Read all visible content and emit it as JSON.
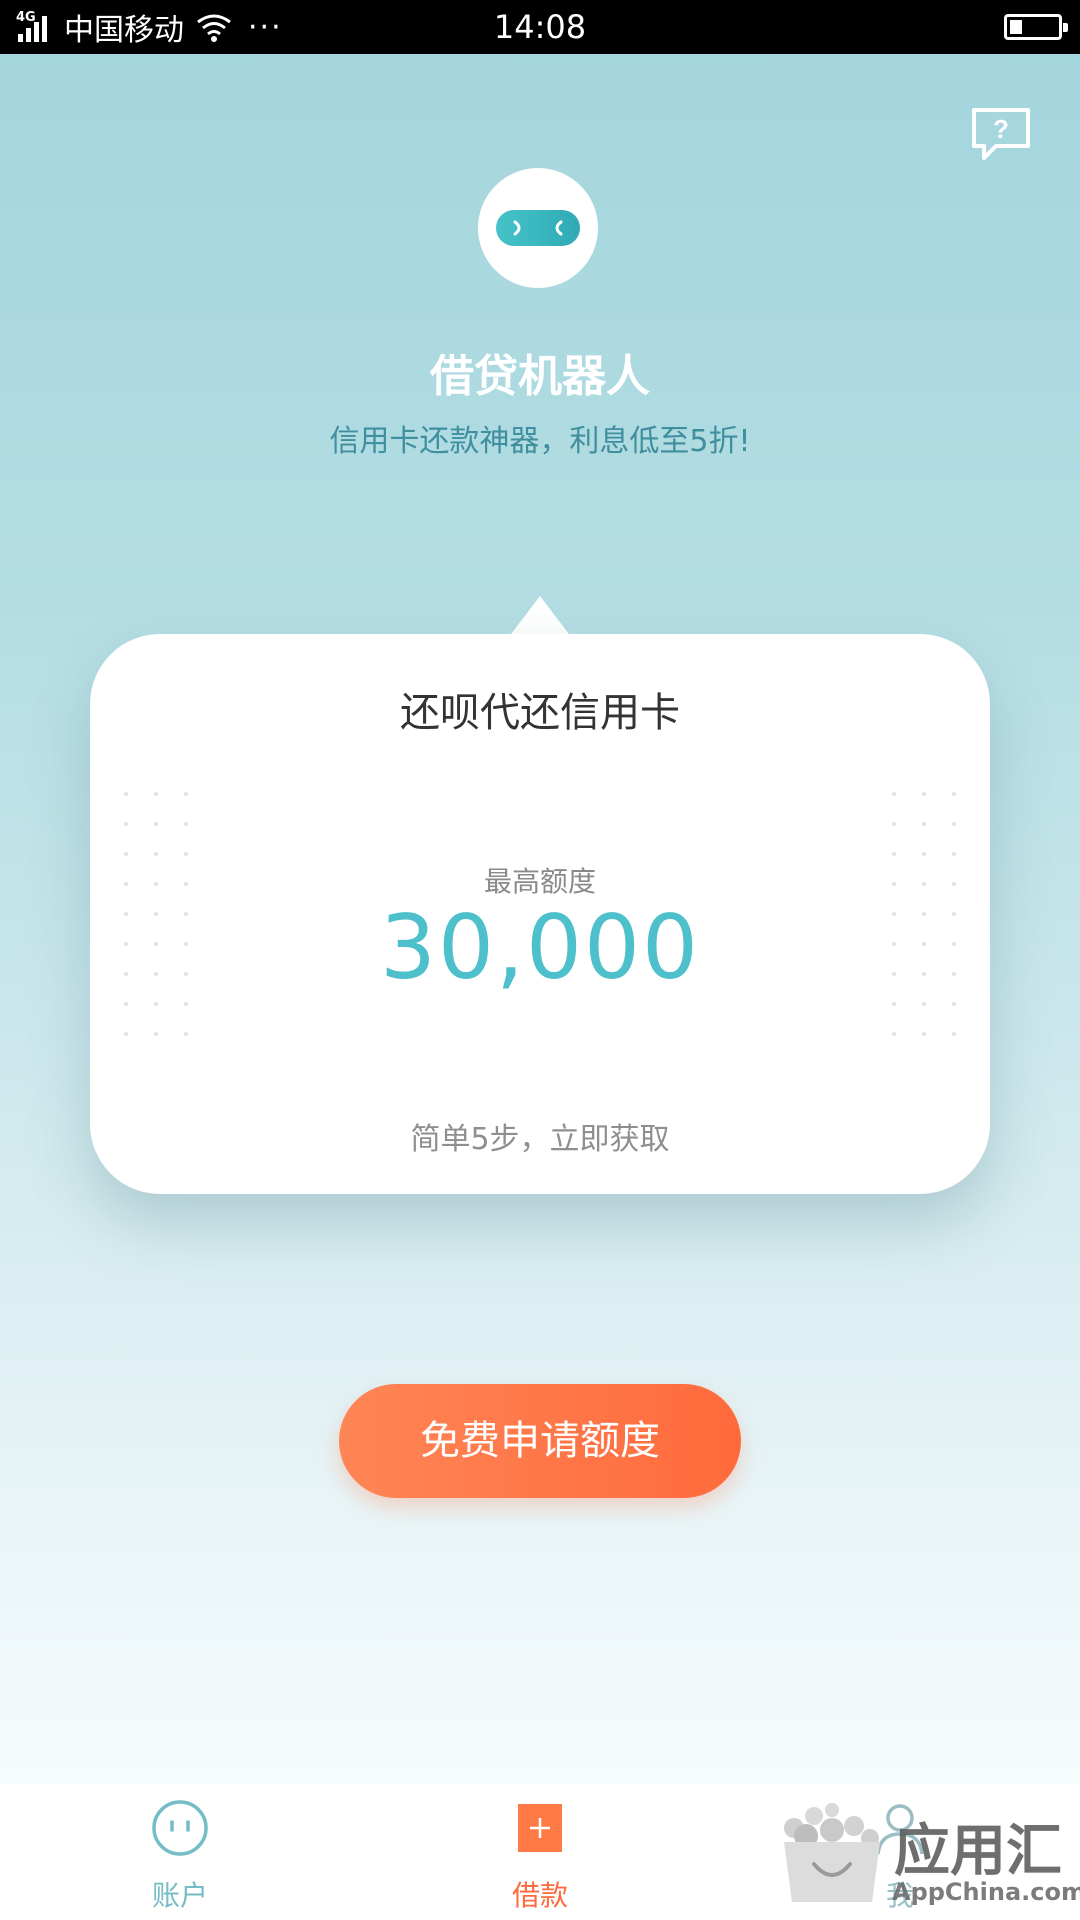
{
  "status_bar": {
    "network": "4G",
    "carrier": "中国移动",
    "more": "···",
    "time": "14:08"
  },
  "header": {
    "help_icon": "question-chat-icon",
    "logo_icon": "robot-face-icon",
    "title": "借贷机器人",
    "subtitle": "信用卡还款神器，利息低至5折!"
  },
  "card": {
    "title": "还呗代还信用卡",
    "label": "最高额度",
    "amount": "30,000",
    "hint": "简单5步，立即获取"
  },
  "apply_button": {
    "label": "免费申请额度"
  },
  "bottom_nav": {
    "items": [
      {
        "label": "账户",
        "icon": "face-circle-icon"
      },
      {
        "label": "借款",
        "icon": "plus-square-icon"
      },
      {
        "label": "我",
        "icon": "person-icon"
      }
    ]
  },
  "watermark": {
    "text": "应用汇",
    "sub": "AppChina.com"
  },
  "colors": {
    "accent_teal": "#4ec0cc",
    "accent_orange": "#ff6a3c",
    "background_top": "#a3d5dc"
  }
}
